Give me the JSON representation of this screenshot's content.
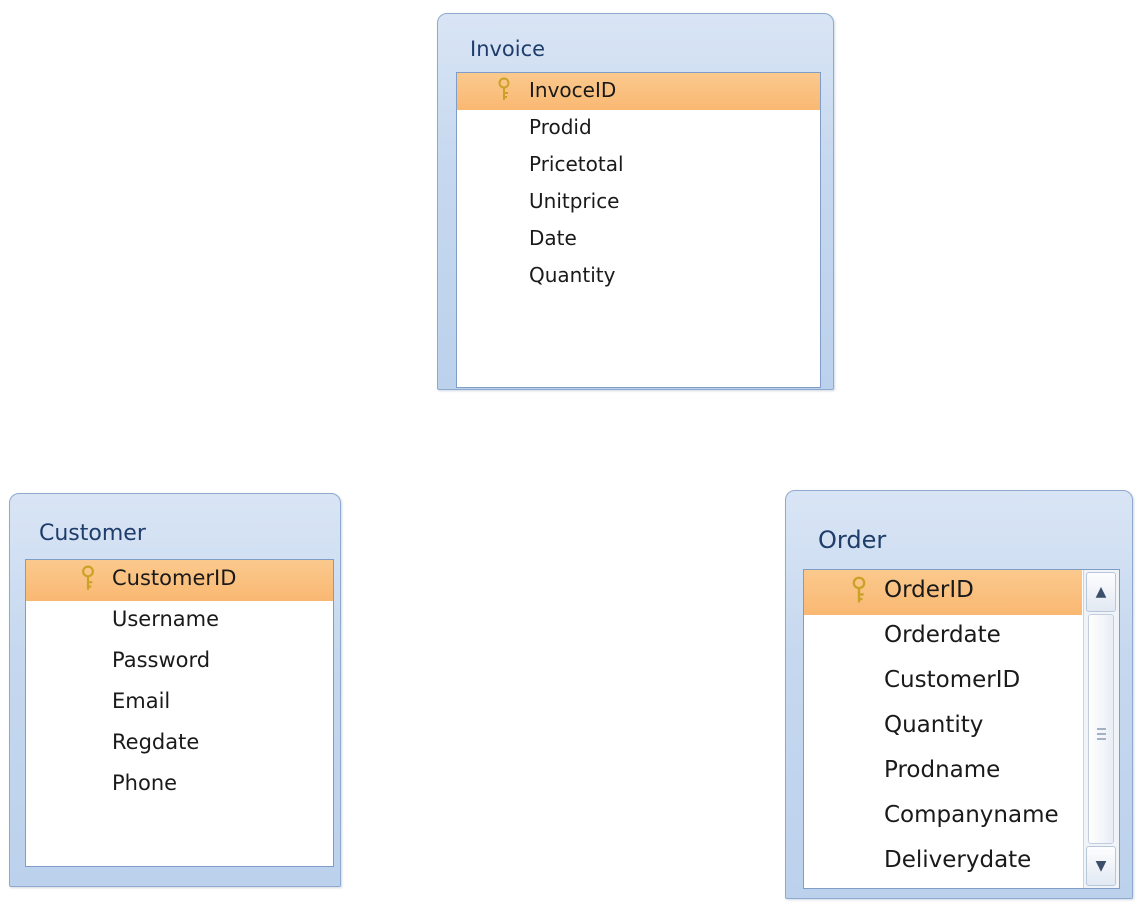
{
  "tables": [
    {
      "name": "Invoice",
      "fields": [
        {
          "label": "InvoceID",
          "primary_key": true
        },
        {
          "label": "Prodid",
          "primary_key": false
        },
        {
          "label": "Pricetotal",
          "primary_key": false
        },
        {
          "label": "Unitprice",
          "primary_key": false
        },
        {
          "label": "Date",
          "primary_key": false
        },
        {
          "label": "Quantity",
          "primary_key": false
        }
      ]
    },
    {
      "name": "Customer",
      "fields": [
        {
          "label": "CustomerID",
          "primary_key": true
        },
        {
          "label": "Username",
          "primary_key": false
        },
        {
          "label": "Password",
          "primary_key": false
        },
        {
          "label": "Email",
          "primary_key": false
        },
        {
          "label": "Regdate",
          "primary_key": false
        },
        {
          "label": "Phone",
          "primary_key": false
        }
      ]
    },
    {
      "name": "Order",
      "fields": [
        {
          "label": "OrderID",
          "primary_key": true
        },
        {
          "label": "Orderdate",
          "primary_key": false
        },
        {
          "label": "CustomerID",
          "primary_key": false
        },
        {
          "label": "Quantity",
          "primary_key": false
        },
        {
          "label": "Prodname",
          "primary_key": false
        },
        {
          "label": "Companyname",
          "primary_key": false
        },
        {
          "label": "Deliverydate",
          "primary_key": false
        }
      ],
      "scrollbar": {
        "up_icon": "scroll-up-arrow-icon",
        "down_icon": "scroll-down-arrow-icon"
      }
    }
  ],
  "colors": {
    "selected_row": "#f9b872",
    "window_frame": "#c6d8ef",
    "title_text": "#1f3d6b",
    "key_icon": "#c9a227"
  },
  "icons": {
    "primary_key": "key-icon"
  }
}
